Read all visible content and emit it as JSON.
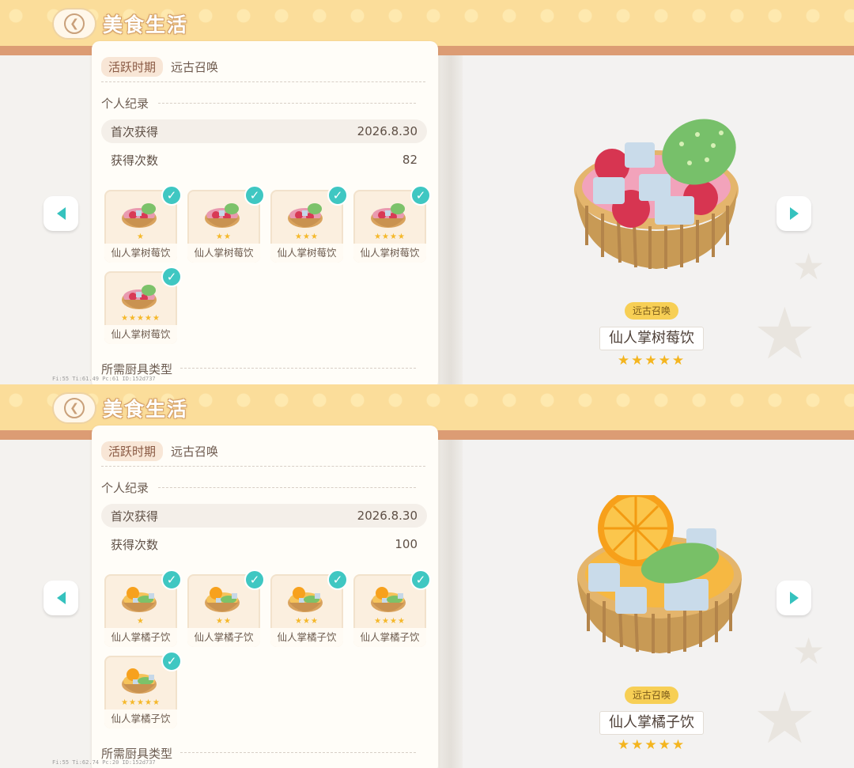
{
  "screens": [
    {
      "title": "美食生活",
      "active_period_label": "活跃时期",
      "active_period_value": "远古召唤",
      "personal_record_label": "个人纪录",
      "first_obtained_label": "首次获得",
      "first_obtained_value": "2026.8.30",
      "obtain_count_label": "获得次数",
      "obtain_count_value": "82",
      "variants": [
        {
          "name": "仙人掌树莓饮",
          "stars": "★"
        },
        {
          "name": "仙人掌树莓饮",
          "stars": "★★"
        },
        {
          "name": "仙人掌树莓饮",
          "stars": "★★★"
        },
        {
          "name": "仙人掌树莓饮",
          "stars": "★★★★"
        },
        {
          "name": "仙人掌树莓饮",
          "stars": "★★★★★"
        }
      ],
      "tool_type_label": "所需厨具类型",
      "era_badge": "远古召唤",
      "item_name": "仙人掌树莓饮",
      "item_stars": "★★★★★",
      "debug_text": "Fi:55  Ti:61.49  Pc:61  ID:152d737",
      "dish_kind": "raspberry"
    },
    {
      "title": "美食生活",
      "active_period_label": "活跃时期",
      "active_period_value": "远古召唤",
      "personal_record_label": "个人纪录",
      "first_obtained_label": "首次获得",
      "first_obtained_value": "2026.8.30",
      "obtain_count_label": "获得次数",
      "obtain_count_value": "100",
      "variants": [
        {
          "name": "仙人掌橘子饮",
          "stars": "★"
        },
        {
          "name": "仙人掌橘子饮",
          "stars": "★★"
        },
        {
          "name": "仙人掌橘子饮",
          "stars": "★★★"
        },
        {
          "name": "仙人掌橘子饮",
          "stars": "★★★★"
        },
        {
          "name": "仙人掌橘子饮",
          "stars": "★★★★★"
        }
      ],
      "tool_type_label": "所需厨具类型",
      "era_badge": "远古召唤",
      "item_name": "仙人掌橘子饮",
      "item_stars": "★★★★★",
      "debug_text": "Fi:55  Ti:62.74  Pc:20  ID:152d737",
      "dish_kind": "orange"
    }
  ],
  "icons": {
    "back": "chevron-left-icon",
    "prev": "triangle-left-icon",
    "next": "triangle-right-icon",
    "check": "check-icon",
    "star": "star-icon"
  },
  "colors": {
    "accent_teal": "#3fc7c2",
    "header_yellow": "#fbdd9a",
    "header_band": "#dc9c74",
    "star_gold": "#f4b51f",
    "badge_yellow": "#f7cf55"
  }
}
